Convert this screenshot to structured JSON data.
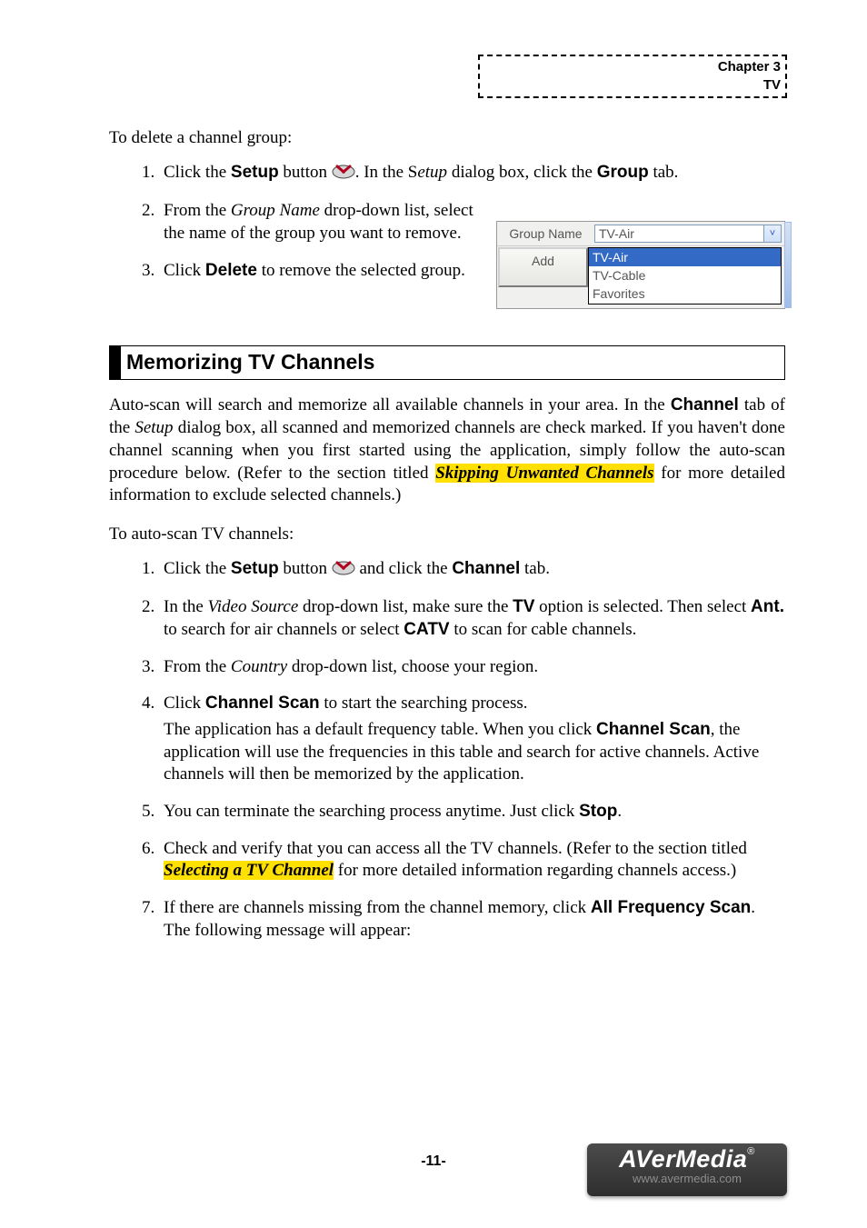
{
  "header": {
    "chapter": "Chapter 3",
    "subject": "TV"
  },
  "delete_group": {
    "intro": "To delete a channel group:",
    "steps": {
      "s1_a": "Click the ",
      "s1_b": "Setup",
      "s1_c": " button ",
      "s1_d": ". In the S",
      "s1_e": "etup",
      "s1_f": " dialog box, click the ",
      "s1_g": "Group",
      "s1_h": " tab.",
      "s2_a": "From the ",
      "s2_b": "Group Name",
      "s2_c": " drop-down list, select the name of the group you want to remove.",
      "s3_a": "Click ",
      "s3_b": "Delete",
      "s3_c": "  to remove the selected group."
    }
  },
  "screenshot": {
    "label": "Group Name",
    "selected": "TV-Air",
    "options": [
      "TV-Air",
      "TV-Cable",
      "Favorites"
    ],
    "add_button": "Add"
  },
  "section_title": "Memorizing TV Channels",
  "memorize": {
    "para_a": "Auto-scan will search and memorize all available channels in your area. In the ",
    "para_b": "Channel",
    "para_c": " tab of the ",
    "para_d": "Setup",
    "para_e": " dialog box, all scanned and memorized channels are check marked. If you haven't done channel scanning when you first started using the application, simply follow the auto-scan procedure below. (Refer to the section titled ",
    "para_f": "Skipping Unwanted Channels",
    "para_g": " for more detailed information to exclude selected channels.)",
    "howto": "To auto-scan TV channels:",
    "steps": {
      "s1_a": "Click the ",
      "s1_b": "Setup",
      "s1_c": " button ",
      "s1_d": " and click the ",
      "s1_e": "Channel",
      "s1_f": " tab.",
      "s2_a": "In the ",
      "s2_b": "Video Source",
      "s2_c": " drop-down list, make sure the ",
      "s2_d": "TV",
      "s2_e": " option is selected. Then select ",
      "s2_f": "Ant.",
      "s2_g": " to search for air channels or select ",
      "s2_h": "CATV",
      "s2_i": " to scan for cable channels.",
      "s3_a": "From the ",
      "s3_b": "Country",
      "s3_c": " drop-down list, choose your region.",
      "s4_a": "Click ",
      "s4_b": "Channel Scan",
      "s4_c": " to start the searching process.",
      "s4_sub_a": "The application has a default frequency table. When you click ",
      "s4_sub_b": "Channel Scan",
      "s4_sub_c": ", the application will use the frequencies in this table and search for active channels. Active channels will then be memorized by the application.",
      "s5_a": "You can terminate the searching process anytime. Just click ",
      "s5_b": "Stop",
      "s5_c": ".",
      "s6_a": "Check and verify that you can access all the TV channels. (Refer to the section titled ",
      "s6_b": "Selecting a TV Channel",
      "s6_c": " for more detailed information regarding channels access.)",
      "s7_a": "If there are channels missing from the channel memory, click ",
      "s7_b": "All Frequency Scan",
      "s7_c": ". The following message will appear:"
    }
  },
  "footer": {
    "page_number": "-11-",
    "brand": "AVerMedia",
    "url": "www.avermedia.com"
  }
}
